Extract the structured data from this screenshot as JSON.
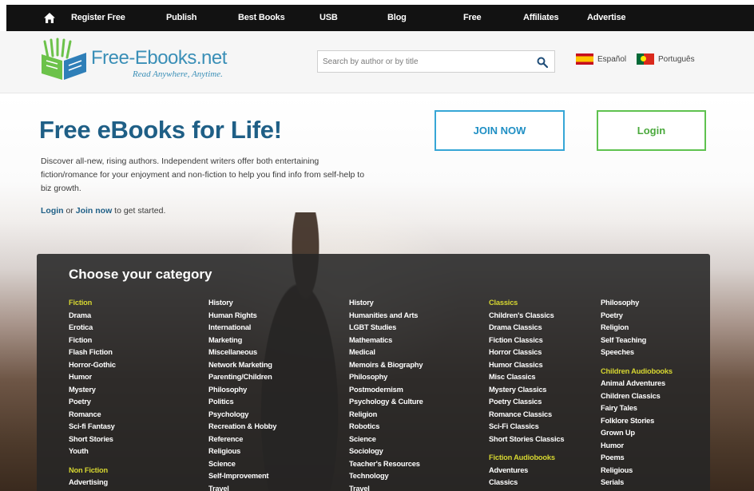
{
  "nav": {
    "items": [
      "Register Free",
      "Publish",
      "Best Books",
      "USB",
      "Blog",
      "Free",
      "Affiliates",
      "Advertise"
    ]
  },
  "header": {
    "logo_text": "Free-Ebooks.net",
    "logo_tagline": "Read Anywhere, Anytime.",
    "search_placeholder": "Search by author or by title",
    "languages": [
      "Español",
      "Português"
    ]
  },
  "hero": {
    "title": "Free eBooks for Life!",
    "description": "Discover all-new, rising authors. Independent writers offer both entertaining fiction/romance for your enjoyment and non-fiction to help you find info from self-help to biz growth.",
    "login_link": "Login",
    "or_text": " or ",
    "join_link": "Join now",
    "cta_suffix": " to get started.",
    "join_button": "JOIN NOW",
    "login_button": "Login"
  },
  "categories": {
    "title": "Choose your category",
    "col1": {
      "heading": "Fiction",
      "items": [
        "Drama",
        "Erotica",
        "Fiction",
        "Flash Fiction",
        "Horror-Gothic",
        "Humor",
        "Mystery",
        "Poetry",
        "Romance",
        "Sci-fi Fantasy",
        "Short Stories",
        "Youth"
      ],
      "heading2": "Non Fiction",
      "items2": [
        "Advertising"
      ]
    },
    "col2": {
      "items": [
        "History",
        "Human Rights",
        "International",
        "Marketing",
        "Miscellaneous",
        "Network Marketing",
        "Parenting/Children",
        "Philosophy",
        "Politics",
        "Psychology",
        "Recreation & Hobby",
        "Reference",
        "Religious",
        "Science",
        "Self-Improvement",
        "Travel"
      ]
    },
    "col3": {
      "items": [
        "History",
        "Humanities and Arts",
        "LGBT Studies",
        "Mathematics",
        "Medical",
        "Memoirs & Biography",
        "Philosophy",
        "Postmodernism",
        "Psychology & Culture",
        "Religion",
        "Robotics",
        "Science",
        "Sociology",
        "Teacher's Resources",
        "Technology",
        "Travel"
      ]
    },
    "col4": {
      "heading": "Classics",
      "items": [
        "Children's Classics",
        "Drama Classics",
        "Fiction Classics",
        "Horror Classics",
        "Humor Classics",
        "Misc Classics",
        "Mystery Classics",
        "Poetry Classics",
        "Romance Classics",
        "Sci-Fi Classics",
        "Short Stories Classics"
      ],
      "heading2": "Fiction Audiobooks",
      "items2": [
        "Adventures",
        "Classics"
      ]
    },
    "col5": {
      "items": [
        "Philosophy",
        "Poetry",
        "Religion",
        "Self Teaching",
        "Speeches"
      ],
      "heading2": "Children Audiobooks",
      "items2": [
        "Animal Adventures",
        "Children Classics",
        "Fairy Tales",
        "Folklore Stories",
        "Grown Up",
        "Humor",
        "Poems",
        "Religious",
        "Serials"
      ]
    }
  },
  "colors": {
    "nav_bg": "#121212",
    "brand_blue": "#3a8fb7",
    "join_border": "#36a6d6",
    "login_border": "#5fc24f",
    "category_heading": "#d6d631"
  }
}
